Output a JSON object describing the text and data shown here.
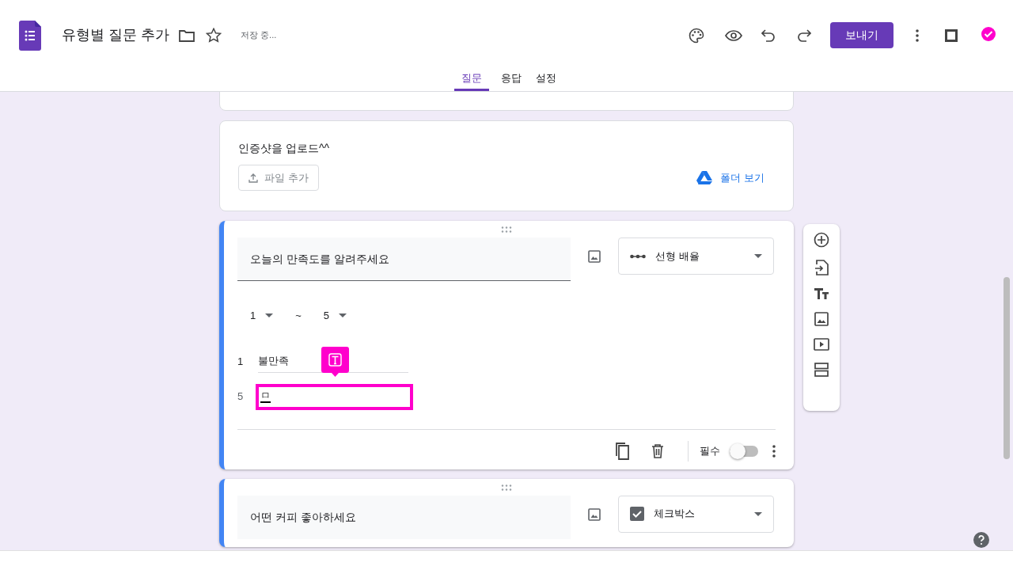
{
  "header": {
    "title": "유형별 질문 추가",
    "save_status": "저장 중...",
    "send_button": "보내기"
  },
  "tabs": [
    {
      "label": "질문",
      "selected": true
    },
    {
      "label": "응답",
      "selected": false
    },
    {
      "label": "설정",
      "selected": false
    }
  ],
  "upload_question": {
    "title": "인증샷을 업로드^^",
    "add_file_button": "파일 추가",
    "folder_link": "폴더 보기"
  },
  "active_question": {
    "title": "오늘의 만족도를 알려주세요",
    "type": "선형 배율",
    "kind": "linear_scale",
    "scale_min": "1",
    "scale_separator": "~",
    "scale_max": "5",
    "labels": [
      {
        "number": "1",
        "value": "불만족",
        "highlighted": false
      },
      {
        "number": "5",
        "value": "ㅁ",
        "highlighted": true
      }
    ],
    "required_label": "필수",
    "required": false
  },
  "next_question": {
    "title": "어떤 커피 좋아하세요",
    "type": "체크박스",
    "kind": "checkbox"
  }
}
